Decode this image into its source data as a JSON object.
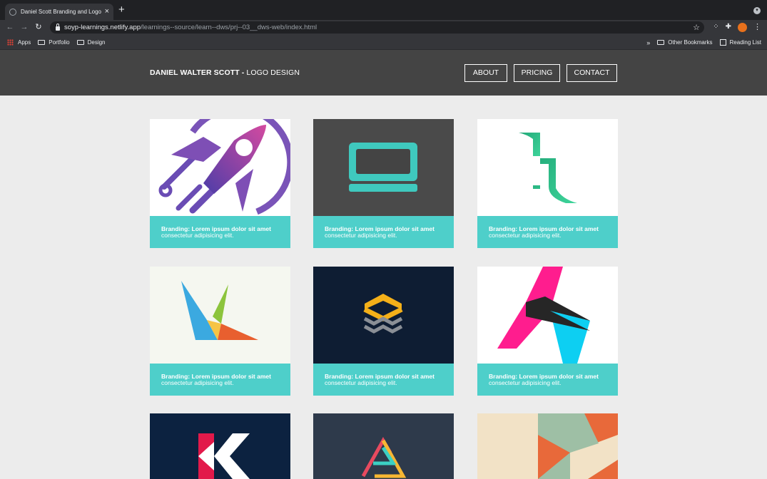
{
  "browser": {
    "tab_title": "Daniel Scott Branding and Logo",
    "url_host": "soyp-learnings.netlify.app",
    "url_path": "/learnings--source/learn--dws/prj--03__dws-web/index.html",
    "bookmarks": [
      "Apps",
      "Portfolio",
      "Design"
    ],
    "bookmarks_overflow": "»",
    "other_bookmarks": "Other Bookmarks",
    "reading_list": "Reading List"
  },
  "site": {
    "brand_bold": "DANIEL WALTER SCOTT -",
    "brand_rest": " LOGO DESIGN",
    "nav": [
      "ABOUT",
      "PRICING",
      "CONTACT"
    ]
  },
  "cards": [
    {
      "logo": "rocket-logo",
      "title": "Branding: Lorem ipsum dolor sit amet",
      "text": "consectetur adipisicing elit."
    },
    {
      "logo": "laptop-logo",
      "title": "Branding: Lorem ipsum dolor sit amet",
      "text": "consectetur adipisicing elit."
    },
    {
      "logo": "green-b-logo",
      "title": "Branding: Lorem ipsum dolor sit amet",
      "text": "consectetur adipisicing elit."
    },
    {
      "logo": "bird-v-logo",
      "title": "Branding: Lorem ipsum dolor sit amet",
      "text": "consectetur adipisicing elit."
    },
    {
      "logo": "chevron-stack-logo",
      "title": "Branding: Lorem ipsum dolor sit amet",
      "text": "consectetur adipisicing elit."
    },
    {
      "logo": "pink-cyan-a-logo",
      "title": "Branding: Lorem ipsum dolor sit amet",
      "text": "consectetur adipisicing elit."
    },
    {
      "logo": "red-k-logo"
    },
    {
      "logo": "triangle-a-logo"
    },
    {
      "logo": "geometric-arrow-logo"
    }
  ],
  "colors": {
    "header_bg": "#444444",
    "caption_bg": "#4ecfca",
    "page_bg": "#ececec"
  }
}
